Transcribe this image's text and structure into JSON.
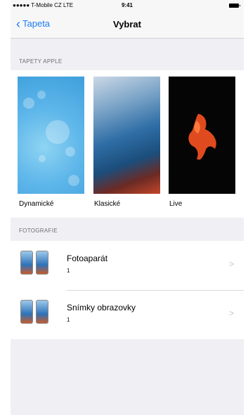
{
  "status_bar": {
    "carrier": "●●●●● T-Mobile CZ  LTE",
    "time": "9:41"
  },
  "nav": {
    "back_label": "Tapeta",
    "title": "Vybrat"
  },
  "sections": {
    "apple": "TAPETY APPLE",
    "photos": "FOTOGRAFIE"
  },
  "wallpapers": [
    {
      "label": "Dynamické"
    },
    {
      "label": "Klasické"
    },
    {
      "label": "Live"
    }
  ],
  "albums": [
    {
      "name": "Fotoaparát",
      "count": "1"
    },
    {
      "name": "Snímky obrazovky",
      "count": "1"
    }
  ],
  "colors": {
    "accent": "#1a7cf5",
    "background": "#efeff4"
  }
}
